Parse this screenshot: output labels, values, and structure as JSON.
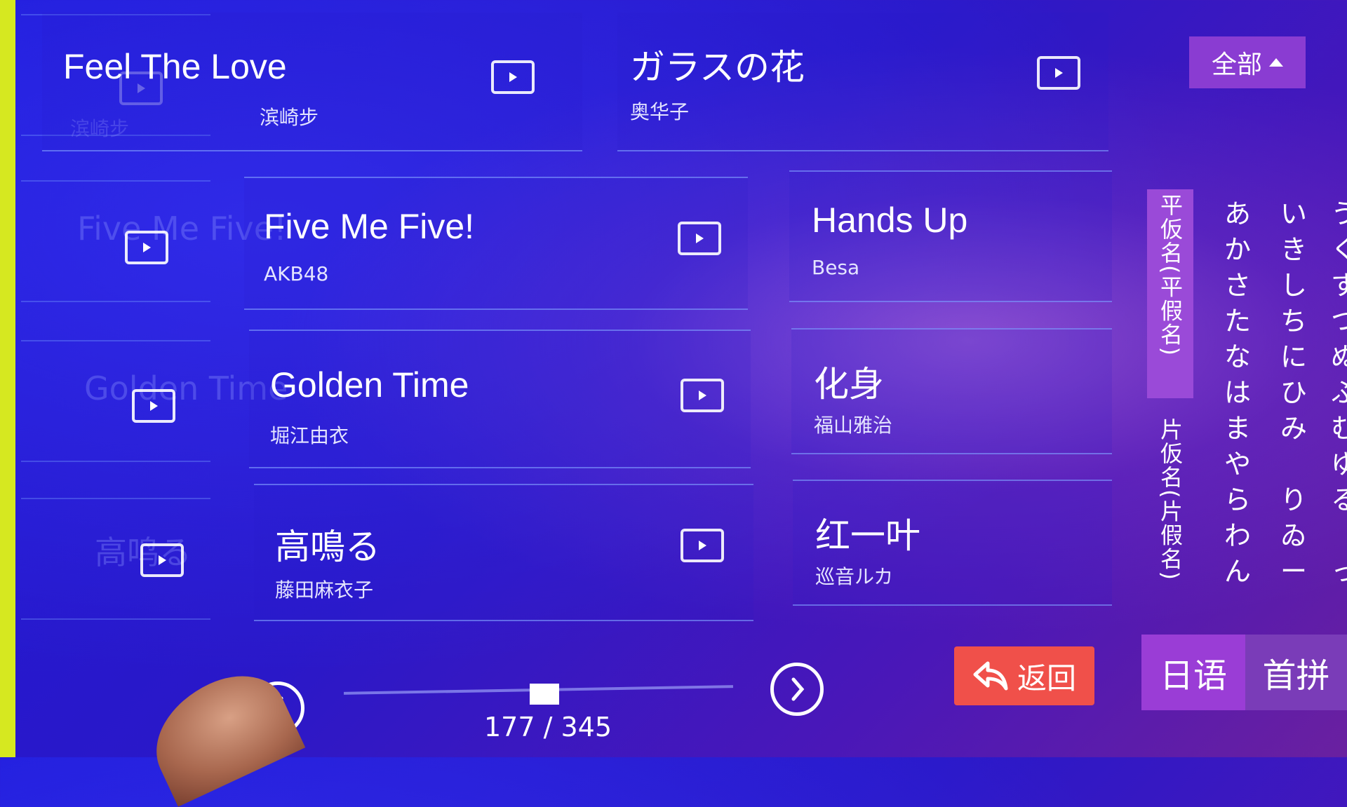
{
  "filter": {
    "label": "全部"
  },
  "ghost_titles": [
    "Five Me Five!",
    "Golden Time",
    "高鸣る"
  ],
  "ghost_artist": "滨崎步",
  "songs": [
    {
      "title": "Feel The Love",
      "artist": "滨崎步"
    },
    {
      "title": "ガラスの花",
      "artist": "奥华子"
    },
    {
      "title": "Five Me Five!",
      "artist": "AKB48"
    },
    {
      "title": "Hands Up",
      "artist": "Besa"
    },
    {
      "title": "Golden Time",
      "artist": "堀江由衣"
    },
    {
      "title": "化身",
      "artist": "福山雅治"
    },
    {
      "title": "高鳴る",
      "artist": "藤田麻衣子"
    },
    {
      "title": "红一叶",
      "artist": "巡音ルカ"
    }
  ],
  "kana": {
    "hiragana_tab": "平仮名(平假名)",
    "katakana_tab": "片仮名(片假名)",
    "columns": [
      [
        "あ",
        "か",
        "さ",
        "た",
        "な",
        "は",
        "ま",
        "や",
        "ら",
        "わ",
        "ん"
      ],
      [
        "い",
        "き",
        "し",
        "ち",
        "に",
        "ひ",
        "み",
        "",
        "り",
        "ゐ",
        "ー"
      ],
      [
        "う",
        "く",
        "す",
        "つ",
        "ぬ",
        "ふ",
        "む",
        "ゆ",
        "る",
        "",
        "っ"
      ]
    ]
  },
  "language": {
    "japanese": "日语",
    "pinyin": "首拼"
  },
  "back": {
    "label": "返回"
  },
  "pagination": {
    "current": 177,
    "total": 345,
    "text": "177 / 345"
  },
  "colors": {
    "accent_purple": "#8a3cd2",
    "back_red": "#f0504a",
    "background_blue": "#2a18c8"
  },
  "icons": {
    "play": "play-icon",
    "back": "undo-arrow-icon",
    "next": "chevron-right-icon",
    "prev": "chevron-left-icon",
    "caret": "caret-up-icon"
  }
}
